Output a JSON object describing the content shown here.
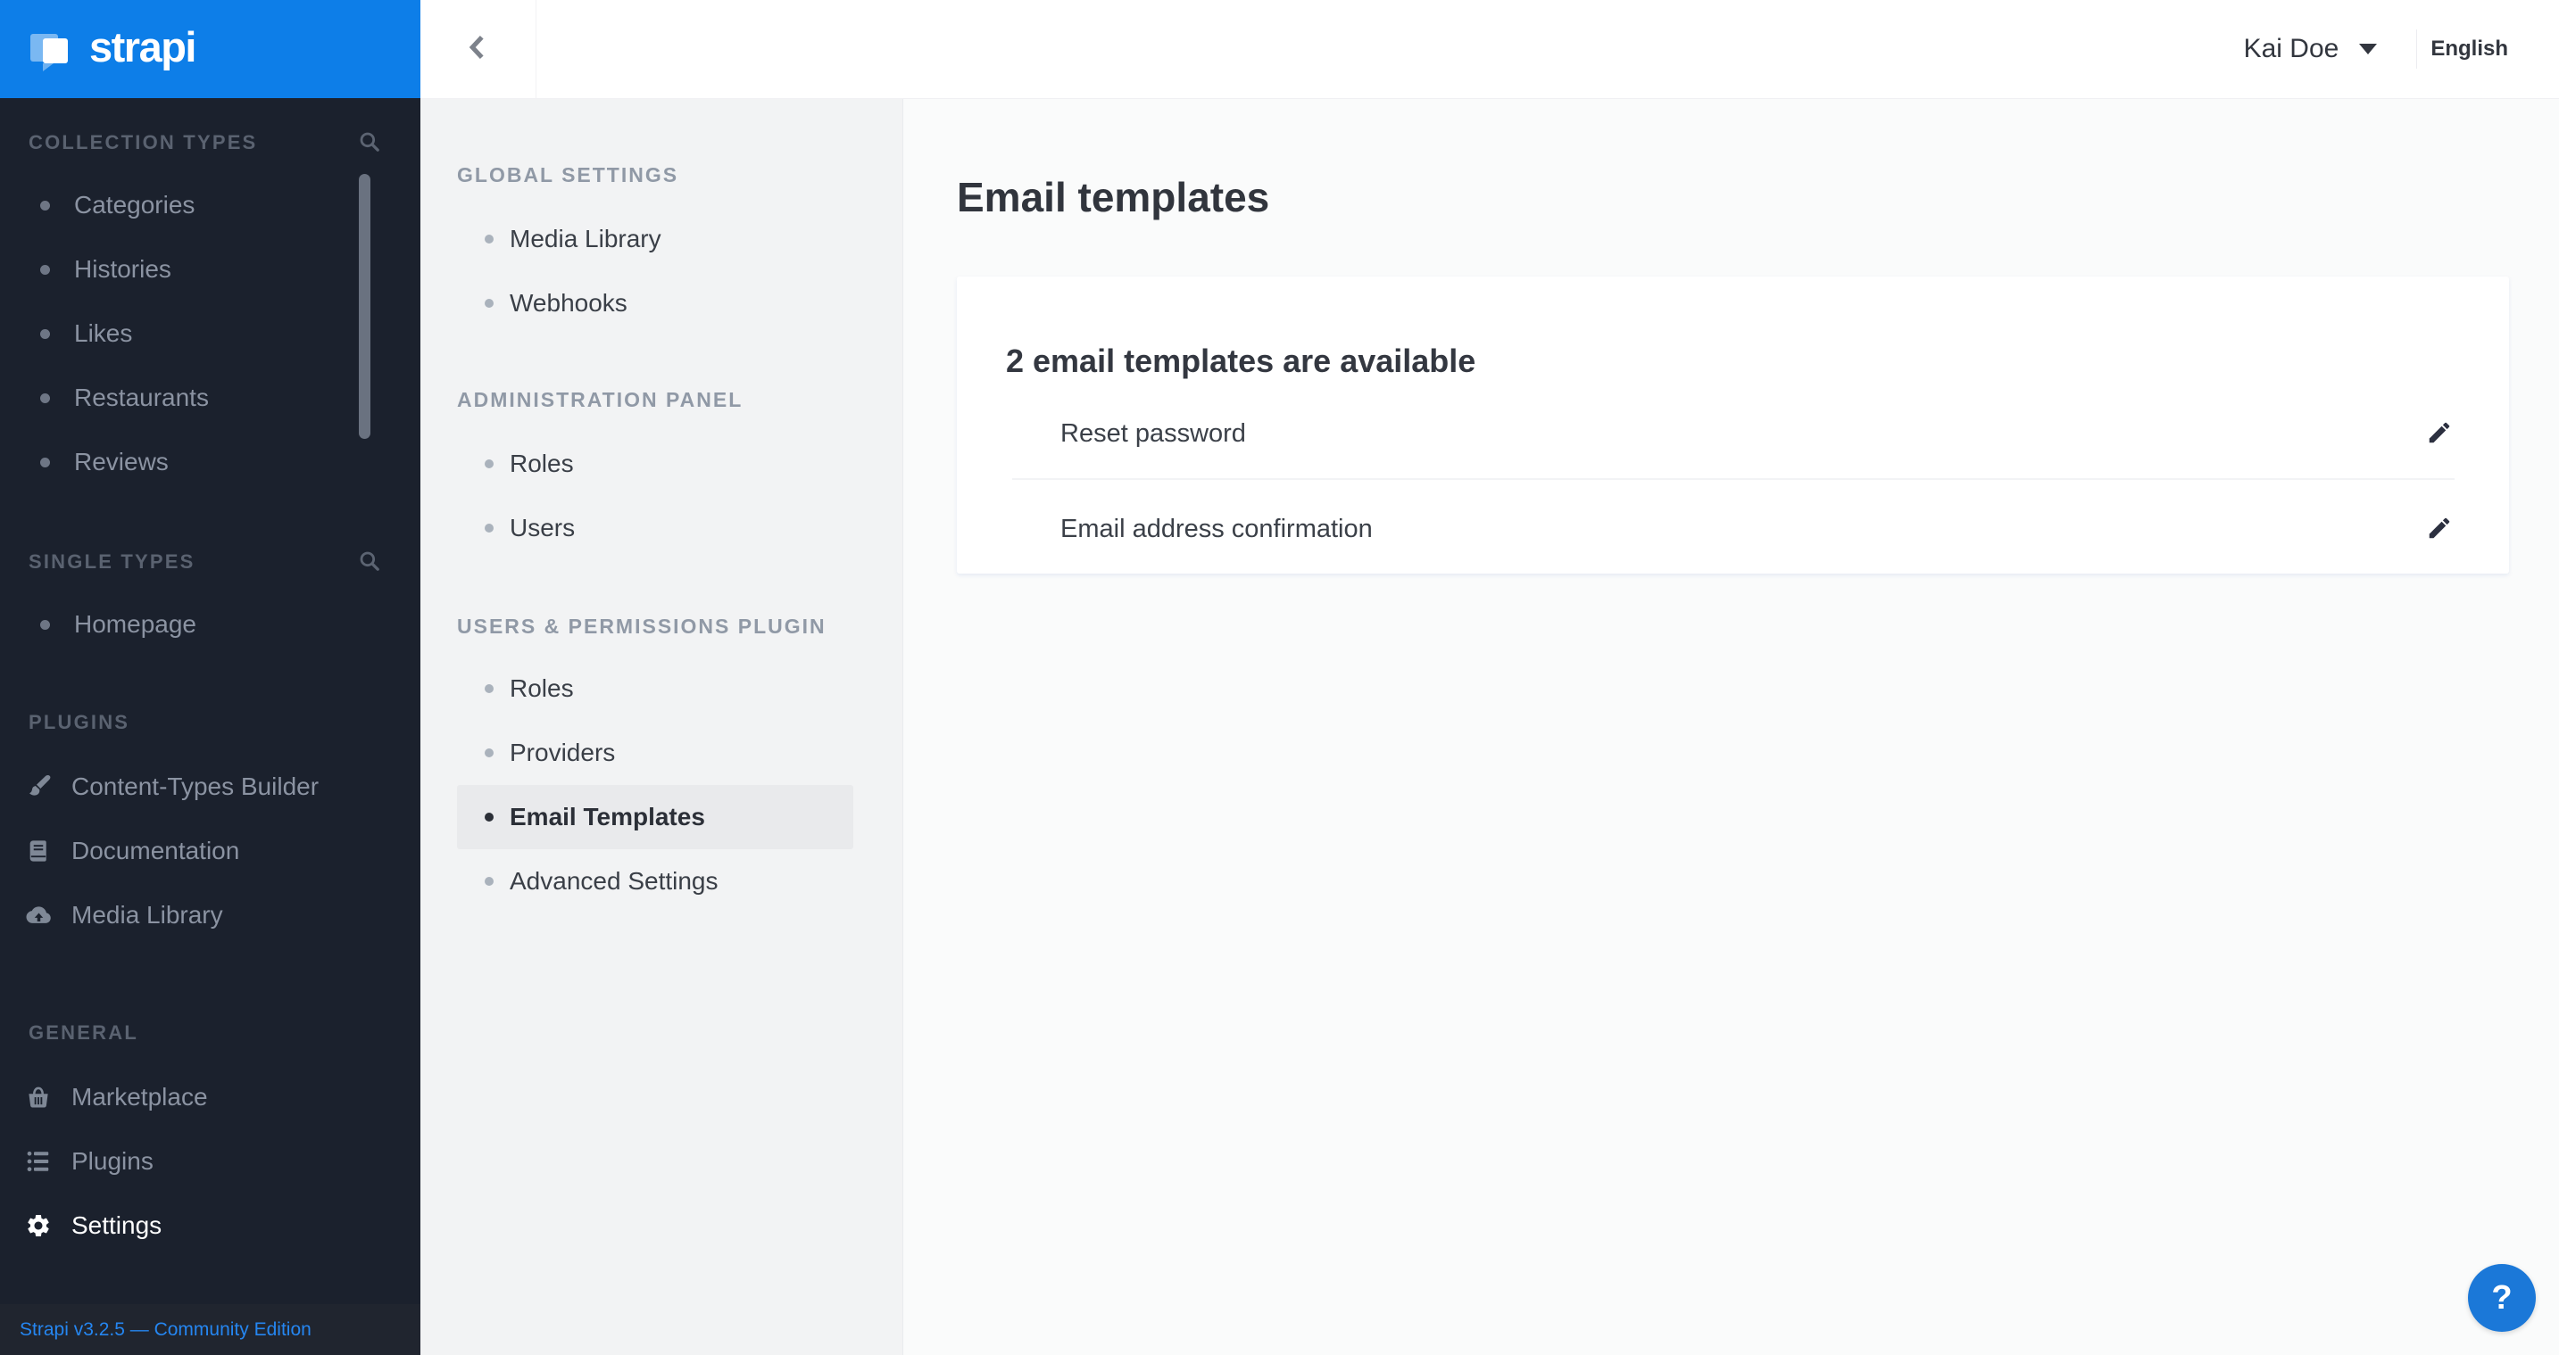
{
  "brand": {
    "logo_text": "strapi",
    "accent_blue": "#0d7ee8",
    "sidebar_bg": "#1b212d"
  },
  "topbar": {
    "user_name": "Kai Doe",
    "language": "English"
  },
  "left_sidebar": {
    "sections": [
      {
        "title": "COLLECTION TYPES",
        "has_search": true,
        "items": [
          {
            "label": "Categories"
          },
          {
            "label": "Histories"
          },
          {
            "label": "Likes"
          },
          {
            "label": "Restaurants"
          },
          {
            "label": "Reviews"
          }
        ]
      },
      {
        "title": "SINGLE TYPES",
        "has_search": true,
        "items": [
          {
            "label": "Homepage"
          }
        ]
      },
      {
        "title": "PLUGINS",
        "items": [
          {
            "label": "Content-Types Builder",
            "icon": "paintbrush-icon"
          },
          {
            "label": "Documentation",
            "icon": "book-icon"
          },
          {
            "label": "Media Library",
            "icon": "cloud-upload-icon"
          }
        ]
      },
      {
        "title": "GENERAL",
        "items": [
          {
            "label": "Marketplace",
            "icon": "basket-icon"
          },
          {
            "label": "Plugins",
            "icon": "list-icon"
          },
          {
            "label": "Settings",
            "icon": "gear-icon",
            "active": true
          }
        ]
      }
    ],
    "footer_version": "Strapi v3.2.5 — Community Edition",
    "footer_link_color": "#2586f1"
  },
  "settings_sidebar": {
    "sections": [
      {
        "title": "GLOBAL SETTINGS",
        "items": [
          {
            "label": "Media Library"
          },
          {
            "label": "Webhooks"
          }
        ]
      },
      {
        "title": "ADMINISTRATION PANEL",
        "items": [
          {
            "label": "Roles"
          },
          {
            "label": "Users"
          }
        ]
      },
      {
        "title": "USERS & PERMISSIONS PLUGIN",
        "items": [
          {
            "label": "Roles"
          },
          {
            "label": "Providers"
          },
          {
            "label": "Email Templates"
          },
          {
            "label": "Advanced Settings"
          }
        ],
        "selected": "Email Templates",
        "selected_bg": "#e9eaec"
      }
    ]
  },
  "main": {
    "page_title": "Email templates",
    "card": {
      "heading": "2 email templates are available",
      "rows": [
        {
          "label": "Reset password"
        },
        {
          "label": "Email address confirmation"
        }
      ]
    }
  },
  "help": {
    "label": "?",
    "bg": "#1b78d8"
  }
}
